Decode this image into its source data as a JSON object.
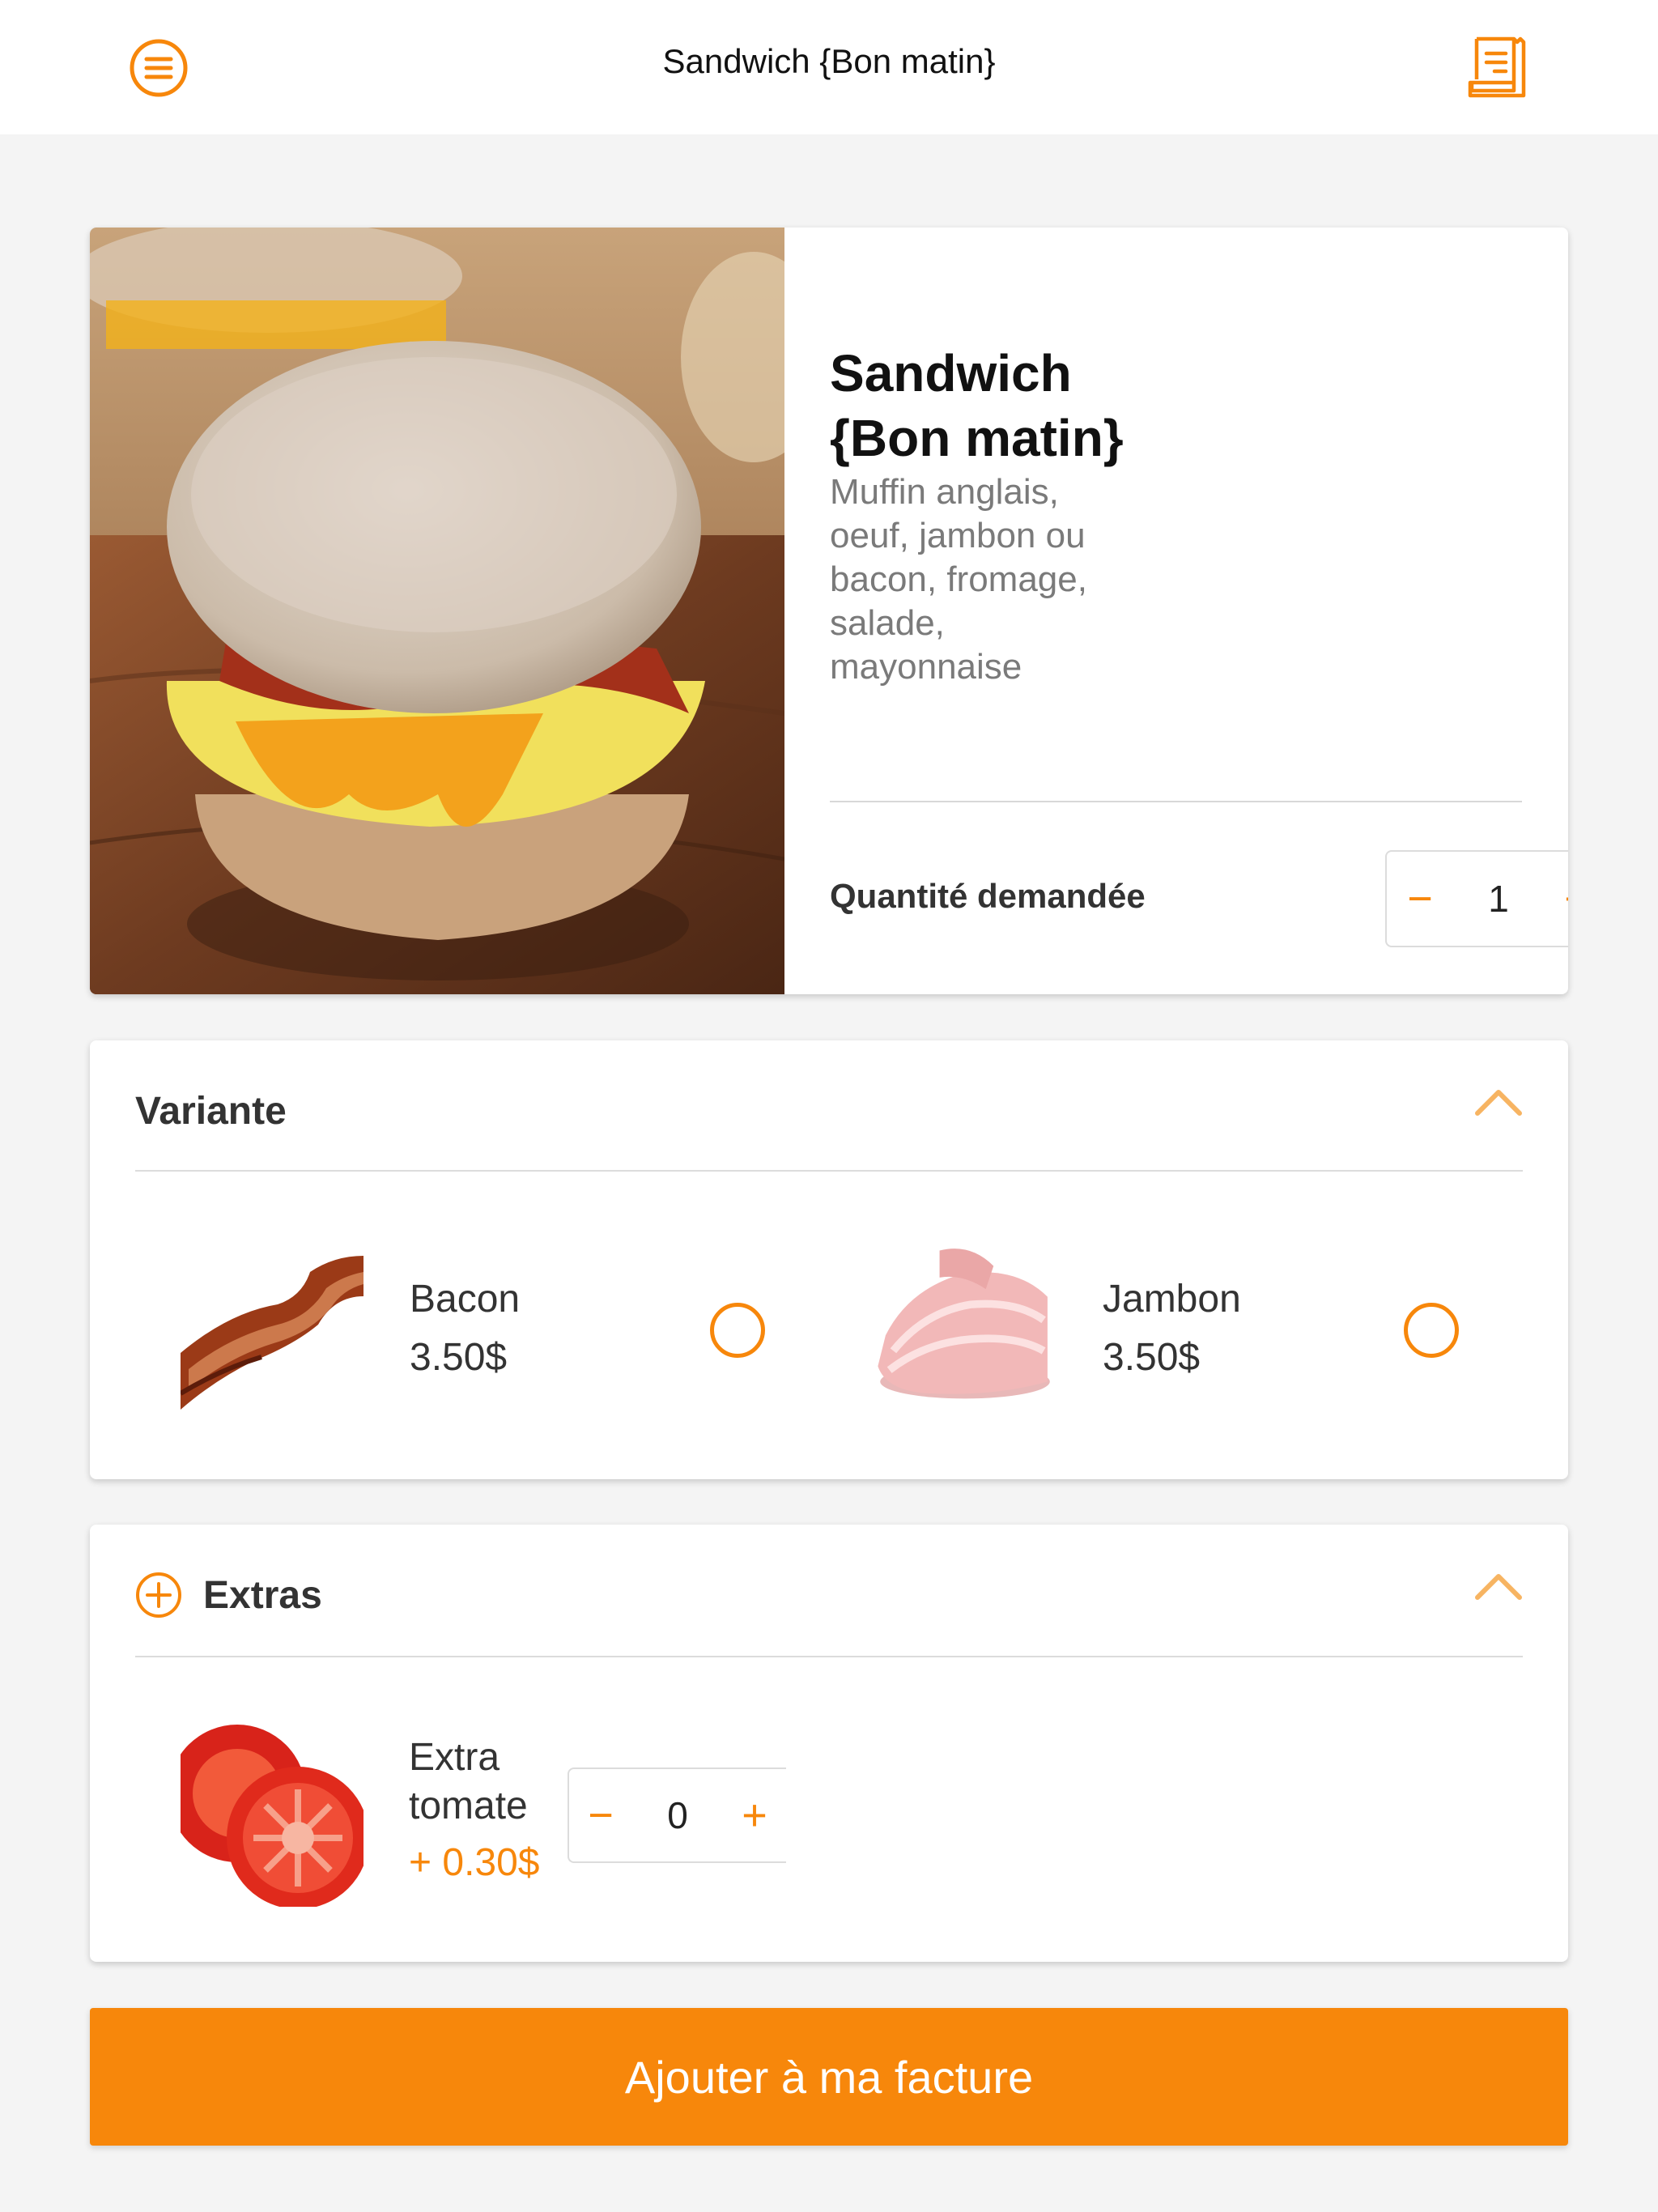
{
  "header": {
    "title": "Sandwich {Bon matin}",
    "menu_icon": "menu-lines-icon",
    "receipt_icon": "receipt-icon"
  },
  "product": {
    "name_line1": "Sandwich",
    "name_line2": "{Bon matin}",
    "description": [
      "Muffin anglais,",
      "oeuf, jambon ou",
      "bacon, fromage,",
      "salade,",
      "mayonnaise"
    ],
    "quantity_label": "Quantité demandée",
    "quantity": "1",
    "minus": "−",
    "plus": "+"
  },
  "variant": {
    "title": "Variante",
    "options": [
      {
        "name": "Bacon",
        "price": "3.50$"
      },
      {
        "name": "Jambon",
        "price": "3.50$"
      }
    ]
  },
  "extras": {
    "title": "Extras",
    "items": [
      {
        "name_line1": "Extra",
        "name_line2": "tomate",
        "price": "+ 0.30$",
        "quantity": "0",
        "minus": "−",
        "plus": "+"
      }
    ]
  },
  "footer": {
    "button_label": "Ajouter à ma facture"
  },
  "colors": {
    "accent": "#f7870b",
    "background": "#f4f4f4",
    "card": "#ffffff"
  }
}
